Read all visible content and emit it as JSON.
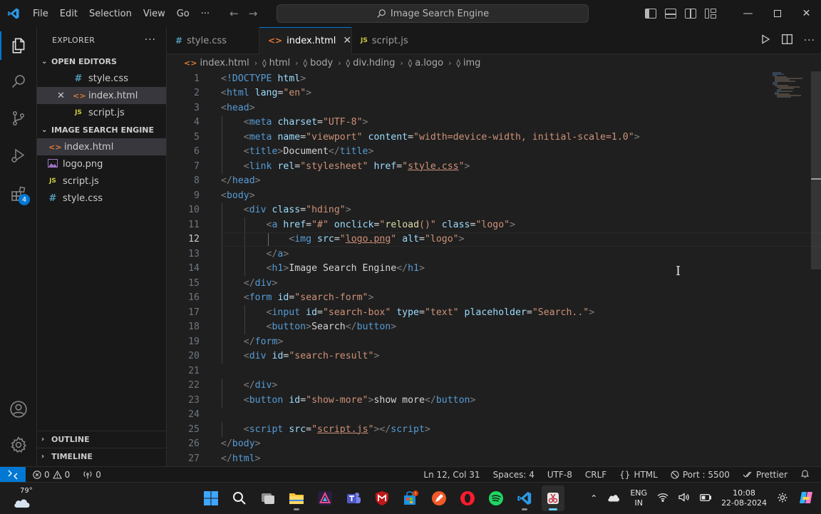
{
  "menu": [
    "File",
    "Edit",
    "Selection",
    "View",
    "Go",
    "···"
  ],
  "command_center": "Image Search Engine",
  "explorer": {
    "title": "EXPLORER",
    "open_editors_label": "OPEN EDITORS",
    "open_editors": [
      {
        "name": "style.css",
        "type": "css"
      },
      {
        "name": "index.html",
        "type": "html"
      },
      {
        "name": "script.js",
        "type": "js"
      }
    ],
    "project_label": "IMAGE SEARCH ENGINE",
    "files": [
      {
        "name": "index.html",
        "type": "html"
      },
      {
        "name": "logo.png",
        "type": "png"
      },
      {
        "name": "script.js",
        "type": "js"
      },
      {
        "name": "style.css",
        "type": "css"
      }
    ],
    "outline_label": "OUTLINE",
    "timeline_label": "TIMELINE"
  },
  "tabs": [
    {
      "name": "style.css",
      "icon": "#",
      "color": "#519aba"
    },
    {
      "name": "index.html",
      "icon": "<>",
      "color": "#e37933"
    },
    {
      "name": "script.js",
      "icon": "JS",
      "color": "#cbcb41"
    }
  ],
  "breadcrumbs": [
    "index.html",
    "html",
    "body",
    "div.hding",
    "a.logo",
    "img"
  ],
  "current_line": 12,
  "code_lines": [
    [
      [
        "t-punc",
        "<"
      ],
      [
        "t-tag",
        "!DOCTYPE"
      ],
      [
        "t-text",
        " "
      ],
      [
        "t-attr",
        "html"
      ],
      [
        "t-punc",
        ">"
      ]
    ],
    [
      [
        "t-punc",
        "<"
      ],
      [
        "t-tag",
        "html"
      ],
      [
        "t-text",
        " "
      ],
      [
        "t-attr",
        "lang"
      ],
      [
        "t-text",
        "="
      ],
      [
        "t-str",
        "\"en\""
      ],
      [
        "t-punc",
        ">"
      ]
    ],
    [
      [
        "t-punc",
        "<"
      ],
      [
        "t-tag",
        "head"
      ],
      [
        "t-punc",
        ">"
      ]
    ],
    [
      [
        "t-text",
        "    "
      ],
      [
        "t-punc",
        "<"
      ],
      [
        "t-tag",
        "meta"
      ],
      [
        "t-text",
        " "
      ],
      [
        "t-attr",
        "charset"
      ],
      [
        "t-text",
        "="
      ],
      [
        "t-str",
        "\"UTF-8\""
      ],
      [
        "t-punc",
        ">"
      ]
    ],
    [
      [
        "t-text",
        "    "
      ],
      [
        "t-punc",
        "<"
      ],
      [
        "t-tag",
        "meta"
      ],
      [
        "t-text",
        " "
      ],
      [
        "t-attr",
        "name"
      ],
      [
        "t-text",
        "="
      ],
      [
        "t-str",
        "\"viewport\""
      ],
      [
        "t-text",
        " "
      ],
      [
        "t-attr",
        "content"
      ],
      [
        "t-text",
        "="
      ],
      [
        "t-str",
        "\"width=device-width, initial-scale=1.0\""
      ],
      [
        "t-punc",
        ">"
      ]
    ],
    [
      [
        "t-text",
        "    "
      ],
      [
        "t-punc",
        "<"
      ],
      [
        "t-tag",
        "title"
      ],
      [
        "t-punc",
        ">"
      ],
      [
        "t-text",
        "Document"
      ],
      [
        "t-punc",
        "</"
      ],
      [
        "t-tag",
        "title"
      ],
      [
        "t-punc",
        ">"
      ]
    ],
    [
      [
        "t-text",
        "    "
      ],
      [
        "t-punc",
        "<"
      ],
      [
        "t-tag",
        "link"
      ],
      [
        "t-text",
        " "
      ],
      [
        "t-attr",
        "rel"
      ],
      [
        "t-text",
        "="
      ],
      [
        "t-str",
        "\"stylesheet\""
      ],
      [
        "t-text",
        " "
      ],
      [
        "t-attr",
        "href"
      ],
      [
        "t-text",
        "="
      ],
      [
        "t-str",
        "\""
      ],
      [
        "t-str t-ul",
        "style.css"
      ],
      [
        "t-str",
        "\""
      ],
      [
        "t-punc",
        ">"
      ]
    ],
    [
      [
        "t-punc",
        "</"
      ],
      [
        "t-tag",
        "head"
      ],
      [
        "t-punc",
        ">"
      ]
    ],
    [
      [
        "t-punc",
        "<"
      ],
      [
        "t-tag",
        "body"
      ],
      [
        "t-punc",
        ">"
      ]
    ],
    [
      [
        "t-text",
        "    "
      ],
      [
        "t-punc",
        "<"
      ],
      [
        "t-tag",
        "div"
      ],
      [
        "t-text",
        " "
      ],
      [
        "t-attr",
        "class"
      ],
      [
        "t-text",
        "="
      ],
      [
        "t-str",
        "\"hding\""
      ],
      [
        "t-punc",
        ">"
      ]
    ],
    [
      [
        "t-text",
        "        "
      ],
      [
        "t-punc",
        "<"
      ],
      [
        "t-tag",
        "a"
      ],
      [
        "t-text",
        " "
      ],
      [
        "t-attr",
        "href"
      ],
      [
        "t-text",
        "="
      ],
      [
        "t-str",
        "\"#\""
      ],
      [
        "t-text",
        " "
      ],
      [
        "t-attr",
        "onclick"
      ],
      [
        "t-text",
        "="
      ],
      [
        "t-str",
        "\""
      ],
      [
        "t-fn",
        "reload"
      ],
      [
        "t-str",
        "()\""
      ],
      [
        "t-text",
        " "
      ],
      [
        "t-attr",
        "class"
      ],
      [
        "t-text",
        "="
      ],
      [
        "t-str",
        "\"logo\""
      ],
      [
        "t-punc",
        ">"
      ]
    ],
    [
      [
        "t-text",
        "            "
      ],
      [
        "t-punc",
        "<"
      ],
      [
        "t-tag",
        "img"
      ],
      [
        "t-text",
        " "
      ],
      [
        "t-attr",
        "src"
      ],
      [
        "t-text",
        "="
      ],
      [
        "t-str",
        "\""
      ],
      [
        "t-str t-ul",
        "logo.png"
      ],
      [
        "t-str",
        "\""
      ],
      [
        "t-text",
        " "
      ],
      [
        "t-attr",
        "alt"
      ],
      [
        "t-text",
        "="
      ],
      [
        "t-str",
        "\"logo\""
      ],
      [
        "t-punc",
        ">"
      ]
    ],
    [
      [
        "t-text",
        "        "
      ],
      [
        "t-punc",
        "</"
      ],
      [
        "t-tag",
        "a"
      ],
      [
        "t-punc",
        ">"
      ]
    ],
    [
      [
        "t-text",
        "        "
      ],
      [
        "t-punc",
        "<"
      ],
      [
        "t-tag",
        "h1"
      ],
      [
        "t-punc",
        ">"
      ],
      [
        "t-text",
        "Image Search Engine"
      ],
      [
        "t-punc",
        "</"
      ],
      [
        "t-tag",
        "h1"
      ],
      [
        "t-punc",
        ">"
      ]
    ],
    [
      [
        "t-text",
        "    "
      ],
      [
        "t-punc",
        "</"
      ],
      [
        "t-tag",
        "div"
      ],
      [
        "t-punc",
        ">"
      ]
    ],
    [
      [
        "t-text",
        "    "
      ],
      [
        "t-punc",
        "<"
      ],
      [
        "t-tag",
        "form"
      ],
      [
        "t-text",
        " "
      ],
      [
        "t-attr",
        "id"
      ],
      [
        "t-text",
        "="
      ],
      [
        "t-str",
        "\"search-form\""
      ],
      [
        "t-punc",
        ">"
      ]
    ],
    [
      [
        "t-text",
        "        "
      ],
      [
        "t-punc",
        "<"
      ],
      [
        "t-tag",
        "input"
      ],
      [
        "t-text",
        " "
      ],
      [
        "t-attr",
        "id"
      ],
      [
        "t-text",
        "="
      ],
      [
        "t-str",
        "\"search-box\""
      ],
      [
        "t-text",
        " "
      ],
      [
        "t-attr",
        "type"
      ],
      [
        "t-text",
        "="
      ],
      [
        "t-str",
        "\"text\""
      ],
      [
        "t-text",
        " "
      ],
      [
        "t-attr",
        "placeholder"
      ],
      [
        "t-text",
        "="
      ],
      [
        "t-str",
        "\"Search..\""
      ],
      [
        "t-punc",
        ">"
      ]
    ],
    [
      [
        "t-text",
        "        "
      ],
      [
        "t-punc",
        "<"
      ],
      [
        "t-tag",
        "button"
      ],
      [
        "t-punc",
        ">"
      ],
      [
        "t-text",
        "Search"
      ],
      [
        "t-punc",
        "</"
      ],
      [
        "t-tag",
        "button"
      ],
      [
        "t-punc",
        ">"
      ]
    ],
    [
      [
        "t-text",
        "    "
      ],
      [
        "t-punc",
        "</"
      ],
      [
        "t-tag",
        "form"
      ],
      [
        "t-punc",
        ">"
      ]
    ],
    [
      [
        "t-text",
        "    "
      ],
      [
        "t-punc",
        "<"
      ],
      [
        "t-tag",
        "div"
      ],
      [
        "t-text",
        " "
      ],
      [
        "t-attr",
        "id"
      ],
      [
        "t-text",
        "="
      ],
      [
        "t-str",
        "\"search-result\""
      ],
      [
        "t-punc",
        ">"
      ]
    ],
    [],
    [
      [
        "t-text",
        "    "
      ],
      [
        "t-punc",
        "</"
      ],
      [
        "t-tag",
        "div"
      ],
      [
        "t-punc",
        ">"
      ]
    ],
    [
      [
        "t-text",
        "    "
      ],
      [
        "t-punc",
        "<"
      ],
      [
        "t-tag",
        "button"
      ],
      [
        "t-text",
        " "
      ],
      [
        "t-attr",
        "id"
      ],
      [
        "t-text",
        "="
      ],
      [
        "t-str",
        "\"show-more\""
      ],
      [
        "t-punc",
        ">"
      ],
      [
        "t-text",
        "show more"
      ],
      [
        "t-punc",
        "</"
      ],
      [
        "t-tag",
        "button"
      ],
      [
        "t-punc",
        ">"
      ]
    ],
    [],
    [
      [
        "t-text",
        "    "
      ],
      [
        "t-punc",
        "<"
      ],
      [
        "t-tag",
        "script"
      ],
      [
        "t-text",
        " "
      ],
      [
        "t-attr",
        "src"
      ],
      [
        "t-text",
        "="
      ],
      [
        "t-str",
        "\""
      ],
      [
        "t-str t-ul",
        "script.js"
      ],
      [
        "t-str",
        "\""
      ],
      [
        "t-punc",
        "></"
      ],
      [
        "t-tag",
        "script"
      ],
      [
        "t-punc",
        ">"
      ]
    ],
    [
      [
        "t-punc",
        "</"
      ],
      [
        "t-tag",
        "body"
      ],
      [
        "t-punc",
        ">"
      ]
    ],
    [
      [
        "t-punc",
        "</"
      ],
      [
        "t-tag",
        "html"
      ],
      [
        "t-punc",
        ">"
      ]
    ]
  ],
  "status": {
    "errors": "0",
    "warnings": "0",
    "ports": "0",
    "position": "Ln 12, Col 31",
    "spaces": "Spaces: 4",
    "encoding": "UTF-8",
    "eol": "CRLF",
    "language": "HTML",
    "port": "Port : 5500",
    "formatter": "Prettier"
  },
  "taskbar": {
    "temperature": "79°",
    "lang_top": "ENG",
    "lang_bottom": "IN",
    "time": "10:08",
    "date": "22-08-2024"
  },
  "colors": {
    "accent": "#0078d4",
    "html_icon": "#e37933",
    "css_icon": "#519aba",
    "js_icon": "#cbcb41"
  }
}
